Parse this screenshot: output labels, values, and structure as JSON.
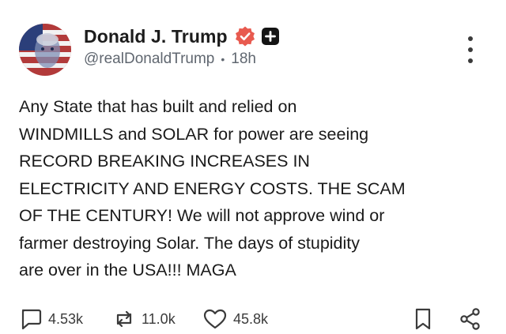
{
  "author": {
    "display_name": "Donald J. Trump",
    "handle": "@realDonaldTrump",
    "separator": "•",
    "time_ago": "18h"
  },
  "post": {
    "text": "Any State that has built and relied on\nWINDMILLS and SOLAR for power are seeing\nRECORD BREAKING INCREASES IN\nELECTRICITY AND ENERGY COSTS. THE SCAM\nOF THE CENTURY! We will not approve wind or\nfarmer destroying Solar. The days of stupidity\nare over in the USA!!! MAGA"
  },
  "actions": {
    "replies": "4.53k",
    "reposts": "11.0k",
    "likes": "45.8k"
  },
  "icons": {
    "verified": "verified-badge-icon",
    "plus": "plus-badge-icon",
    "more": "more-vertical-icon",
    "reply": "comment-icon",
    "repost": "repost-icon",
    "like": "heart-icon",
    "bookmark": "bookmark-icon",
    "share": "share-icon"
  },
  "colors": {
    "verified_badge": "#e85a4f",
    "text": "#1a1a1a",
    "muted": "#606770"
  }
}
